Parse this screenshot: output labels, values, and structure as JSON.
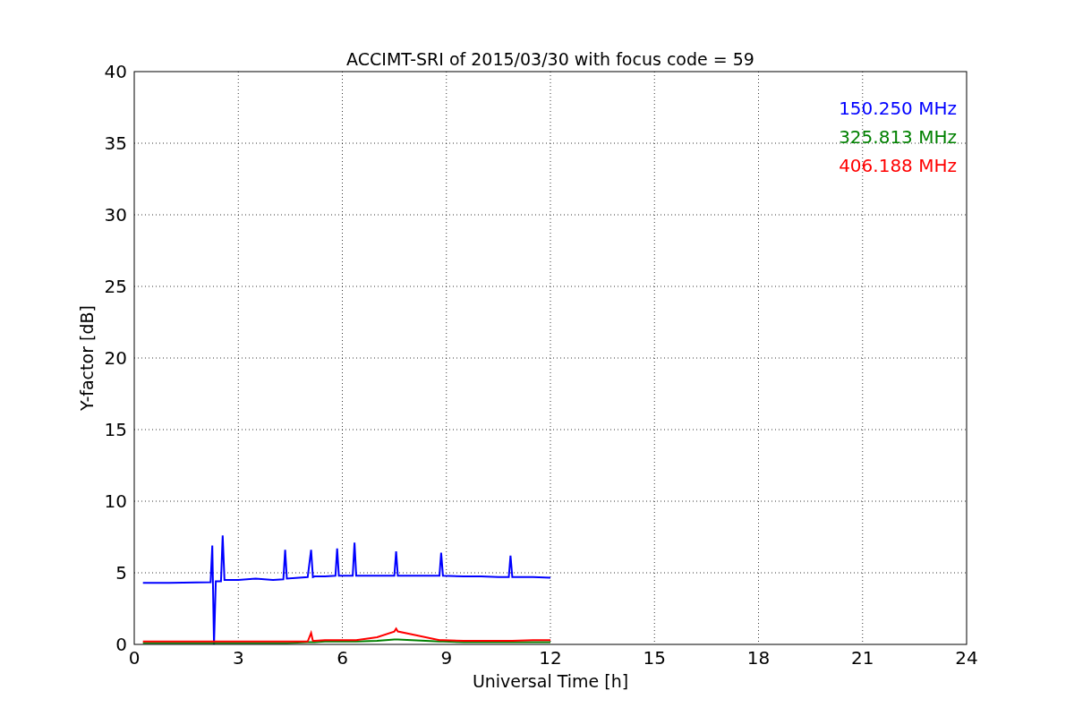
{
  "chart_data": {
    "type": "line",
    "title": "ACCIMT-SRI of 2015/03/30 with focus code = 59",
    "xlabel": "Universal Time [h]",
    "ylabel": "Y-factor [dB]",
    "x": [
      0.25,
      1,
      2.2,
      2.25,
      2.3,
      2.35,
      2.5,
      2.55,
      2.6,
      3,
      3.5,
      4,
      4.3,
      4.35,
      4.4,
      5,
      5.1,
      5.15,
      5.2,
      5.5,
      5.8,
      5.85,
      5.9,
      6.3,
      6.35,
      6.4,
      7,
      7.5,
      7.55,
      7.6,
      8,
      8.8,
      8.85,
      8.9,
      9.5,
      10,
      10.5,
      10.8,
      10.85,
      10.9,
      11.5,
      12
    ],
    "series": [
      {
        "name": "150.250 MHz",
        "color": "#0000ff",
        "values": [
          4.3,
          4.3,
          4.35,
          6.9,
          0,
          4.4,
          4.4,
          7.6,
          4.5,
          4.5,
          4.6,
          4.5,
          4.55,
          6.6,
          4.6,
          4.7,
          6.6,
          4.7,
          4.75,
          4.75,
          4.8,
          6.7,
          4.8,
          4.8,
          7.1,
          4.8,
          4.8,
          4.8,
          6.5,
          4.8,
          4.8,
          4.8,
          6.4,
          4.8,
          4.75,
          4.75,
          4.7,
          4.7,
          6.2,
          4.7,
          4.7,
          4.65
        ]
      },
      {
        "name": "325.813 MHz",
        "color": "#008000",
        "values": [
          0.1,
          0.1,
          0.1,
          0.1,
          0.1,
          0.1,
          0.1,
          0.1,
          0.1,
          0.1,
          0.1,
          0.1,
          0.1,
          0.1,
          0.1,
          0.15,
          0.15,
          0.15,
          0.15,
          0.2,
          0.2,
          0.2,
          0.2,
          0.2,
          0.2,
          0.2,
          0.25,
          0.35,
          0.35,
          0.35,
          0.3,
          0.2,
          0.2,
          0.2,
          0.15,
          0.15,
          0.15,
          0.15,
          0.15,
          0.15,
          0.15,
          0.15
        ]
      },
      {
        "name": "406.188 MHz",
        "color": "#ff0000",
        "values": [
          0.2,
          0.2,
          0.2,
          0.2,
          0.2,
          0.2,
          0.2,
          0.2,
          0.2,
          0.2,
          0.2,
          0.2,
          0.2,
          0.2,
          0.2,
          0.2,
          0.8,
          0.25,
          0.25,
          0.3,
          0.3,
          0.3,
          0.3,
          0.3,
          0.3,
          0.3,
          0.5,
          0.9,
          1.1,
          0.9,
          0.7,
          0.3,
          0.3,
          0.3,
          0.25,
          0.25,
          0.25,
          0.25,
          0.25,
          0.25,
          0.3,
          0.3
        ]
      }
    ],
    "grid": true,
    "xlim": [
      0,
      24
    ],
    "ylim": [
      0,
      40
    ],
    "xticks": [
      0,
      3,
      6,
      9,
      12,
      15,
      18,
      21,
      24
    ],
    "yticks": [
      0,
      5,
      10,
      15,
      20,
      25,
      30,
      35,
      40
    ]
  }
}
